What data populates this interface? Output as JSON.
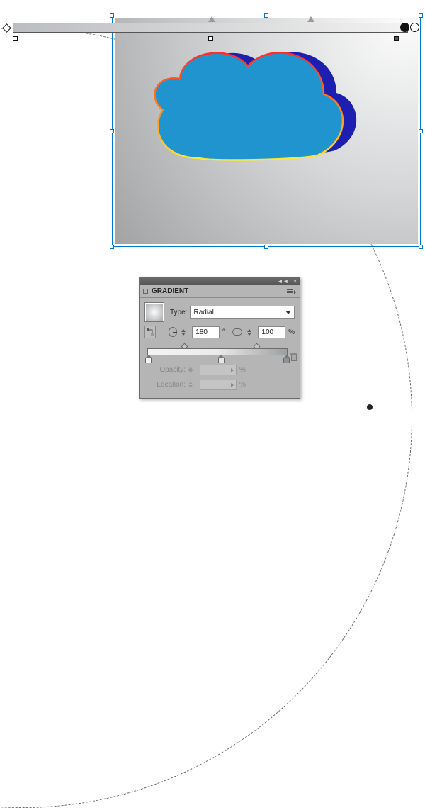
{
  "panel": {
    "title": "GRADIENT",
    "type_label": "Type:",
    "type_value": "Radial",
    "angle_value": "180",
    "angle_unit": "°",
    "aspect_value": "100",
    "aspect_unit": "%",
    "opacity_label": "Opacity:",
    "opacity_unit": "%",
    "location_label": "Location:",
    "location_unit": "%",
    "collapse_glyph": "◄◄",
    "close_glyph": "✕"
  },
  "gradient_slider": {
    "stops": [
      {
        "pos": 0
      },
      {
        "pos": 50
      },
      {
        "pos": 100
      }
    ],
    "midpoints": [
      25,
      75
    ]
  },
  "annotator": {
    "midpoints": [
      50,
      75
    ]
  },
  "colors": {
    "cloud_fill": "#2094ce",
    "cloud_stroke_top": "#ff2a2a",
    "cloud_stroke_bottom": "#ffe933",
    "cloud_shadow": "#1d1fb0"
  }
}
